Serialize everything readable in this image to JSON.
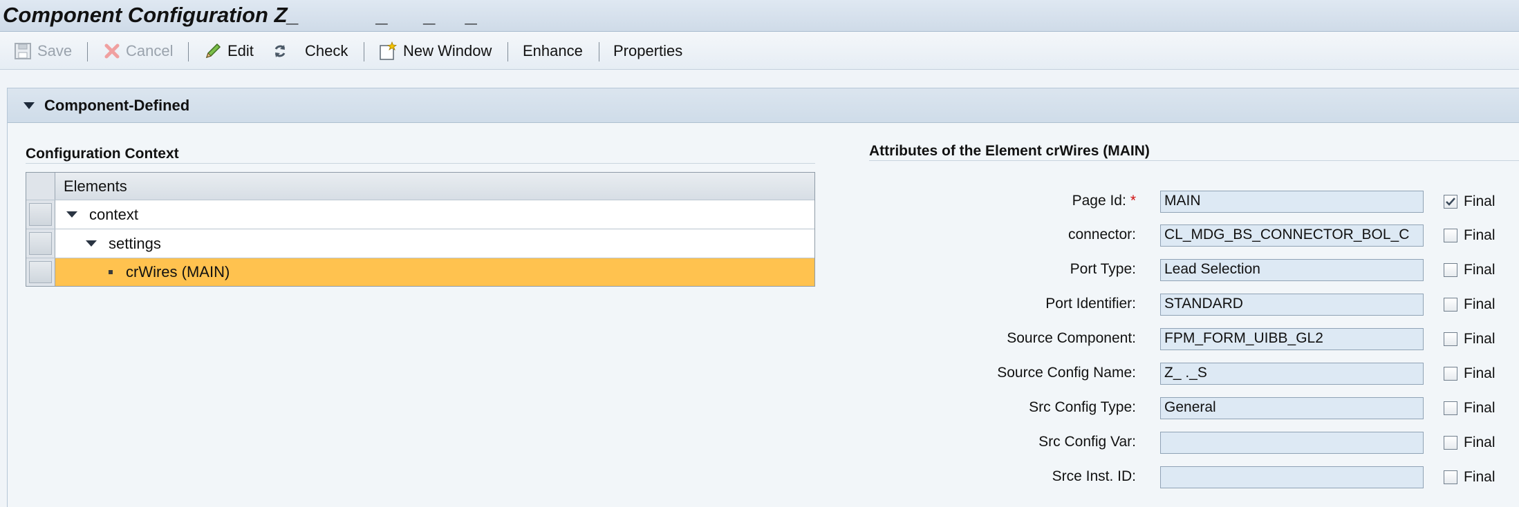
{
  "window": {
    "title": "Component Configuration Z_             _      _     _"
  },
  "toolbar": {
    "save_label": "Save",
    "cancel_label": "Cancel",
    "edit_label": "Edit",
    "check_label": "Check",
    "new_window_label": "New Window",
    "enhance_label": "Enhance",
    "properties_label": "Properties"
  },
  "panel": {
    "title": "Component-Defined"
  },
  "config_context": {
    "title": "Configuration Context",
    "column_header": "Elements",
    "rows": [
      {
        "label": "context",
        "level": 0,
        "expanded": true,
        "selected": false
      },
      {
        "label": "settings",
        "level": 1,
        "expanded": true,
        "selected": false
      },
      {
        "label": "crWires (MAIN)",
        "level": 2,
        "leaf": true,
        "selected": true
      }
    ]
  },
  "attributes": {
    "title": "Attributes of the Element crWires (MAIN)",
    "final_label": "Final",
    "fields": [
      {
        "label": "Page Id:",
        "required": true,
        "value": "MAIN",
        "final": true
      },
      {
        "label": "connector:",
        "required": false,
        "value": "CL_MDG_BS_CONNECTOR_BOL_C",
        "final": false
      },
      {
        "label": "Port Type:",
        "required": false,
        "value": "Lead Selection",
        "final": false
      },
      {
        "label": "Port Identifier:",
        "required": false,
        "value": "STANDARD",
        "final": false
      },
      {
        "label": "Source Component:",
        "required": false,
        "value": "FPM_FORM_UIBB_GL2",
        "final": false
      },
      {
        "label": "Source Config Name:",
        "required": false,
        "value": "Z_                                          ._S",
        "final": false
      },
      {
        "label": "Src Config Type:",
        "required": false,
        "value": "General",
        "final": false
      },
      {
        "label": "Src Config Var:",
        "required": false,
        "value": "",
        "final": false
      },
      {
        "label": "Srce Inst. ID:",
        "required": false,
        "value": "",
        "final": false
      }
    ]
  },
  "colors": {
    "selection": "#ffc24f",
    "input_bg": "#dde9f4",
    "required": "#d01010"
  }
}
